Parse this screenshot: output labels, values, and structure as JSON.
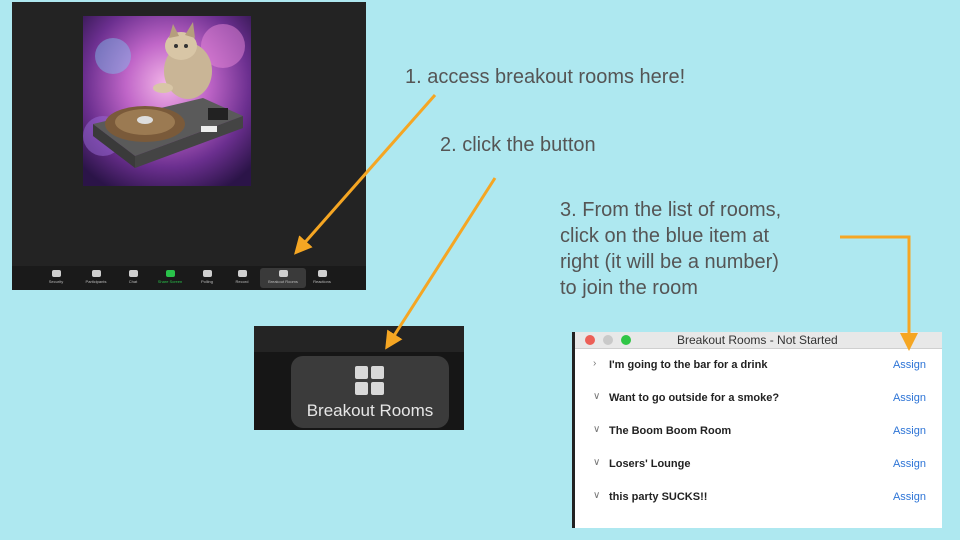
{
  "zoom_window": {
    "toolbar": [
      {
        "label": "Security",
        "icon": "shield-icon"
      },
      {
        "label": "Participants",
        "icon": "participants-icon"
      },
      {
        "label": "Chat",
        "icon": "chat-icon"
      },
      {
        "label": "Share Screen",
        "icon": "share-screen-icon",
        "color": "#29c24a"
      },
      {
        "label": "Polling",
        "icon": "polling-icon"
      },
      {
        "label": "Record",
        "icon": "record-icon"
      },
      {
        "label": "Breakout Rooms",
        "icon": "breakout-rooms-icon"
      },
      {
        "label": "Reactions",
        "icon": "reactions-icon"
      }
    ]
  },
  "notes": {
    "step1": "1. access breakout rooms here!",
    "step2": "2. click the button",
    "step3_line1": "3. From the list of rooms,",
    "step3_line2": "click on the blue item at",
    "step3_line3": "right (it will be a number)",
    "step3_line4": "to join the room"
  },
  "breakout_button": {
    "label": "Breakout Rooms",
    "icon": "grid-icon"
  },
  "panel": {
    "title": "Breakout Rooms - Not Started",
    "rooms": [
      {
        "name": "I'm going to the bar for a drink",
        "action": "Assign",
        "expanded": false
      },
      {
        "name": "Want to go outside for a smoke?",
        "action": "Assign",
        "expanded": true
      },
      {
        "name": "The Boom Boom Room",
        "action": "Assign",
        "expanded": true
      },
      {
        "name": "Losers' Lounge",
        "action": "Assign",
        "expanded": true
      },
      {
        "name": "this party SUCKS!!",
        "action": "Assign",
        "expanded": true
      }
    ]
  },
  "colors": {
    "background": "#aee8f0",
    "arrow": "#f5a623",
    "link": "#2d74d6"
  }
}
